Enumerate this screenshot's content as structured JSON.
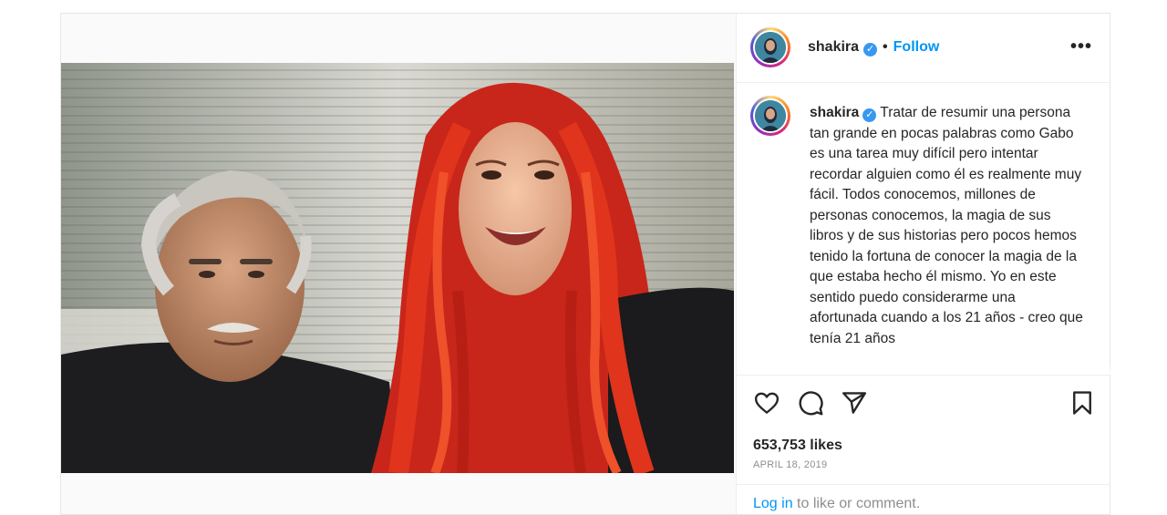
{
  "post": {
    "username": "shakira",
    "follow_label": "Follow",
    "separator": "•",
    "more_label": "•••",
    "caption": "Tratar de resumir una persona tan grande en pocas palabras como Gabo es una tarea muy difícil pero intentar recordar alguien como él es realmente muy fácil. Todos conocemos, millones de personas conocemos, la magia de sus libros y de sus historias pero pocos hemos tenido la fortuna de conocer la magia de la que estaba hecho él mismo. Yo en este sentido puedo considerarme una afortunada cuando a los 21 años - creo que tenía 21 años",
    "likes": "653,753 likes",
    "date": "APRIL 18, 2019",
    "login_link": "Log in",
    "login_suffix": " to like or comment."
  },
  "icons": {
    "verified": "verified-badge-icon",
    "like": "heart-icon",
    "comment": "comment-icon",
    "share": "paper-plane-icon",
    "save": "bookmark-icon"
  },
  "colors": {
    "accent": "#0095f6",
    "verified": "#3897f0",
    "text": "#262626",
    "muted": "#8e8e8e",
    "hair": "#e0341c"
  }
}
